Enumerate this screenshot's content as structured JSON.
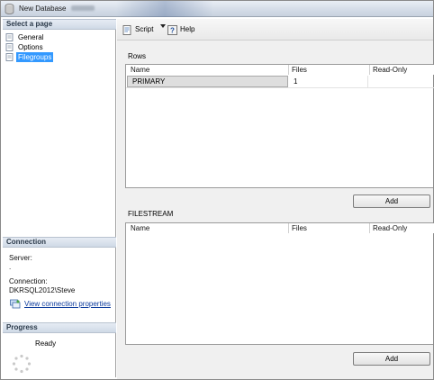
{
  "window": {
    "title": "New Database"
  },
  "left_pane": {
    "select_page_header": "Select a page",
    "pages": [
      {
        "label": "General"
      },
      {
        "label": "Options"
      },
      {
        "label": "Filegroups"
      }
    ],
    "connection_header": "Connection",
    "server_label": "Server:",
    "server_value": ".",
    "connection_label": "Connection:",
    "connection_value": "DKRSQL2012\\Steve",
    "view_connection_link": "View connection properties",
    "progress_header": "Progress",
    "progress_status": "Ready"
  },
  "toolbar": {
    "script_label": "Script",
    "help_label": "Help"
  },
  "rows_section": {
    "label": "Rows",
    "columns": [
      "Name",
      "Files",
      "Read-Only"
    ],
    "rows": [
      {
        "name": "PRIMARY",
        "files": "1",
        "read_only": ""
      }
    ],
    "add_label": "Add"
  },
  "filestream_section": {
    "label": "FILESTREAM",
    "columns": [
      "Name",
      "Files",
      "Read-Only"
    ],
    "add_label": "Add"
  },
  "colors": {
    "selection": "#3399ff",
    "link": "#0b3a9c",
    "section_header": "#cfd9e6"
  }
}
